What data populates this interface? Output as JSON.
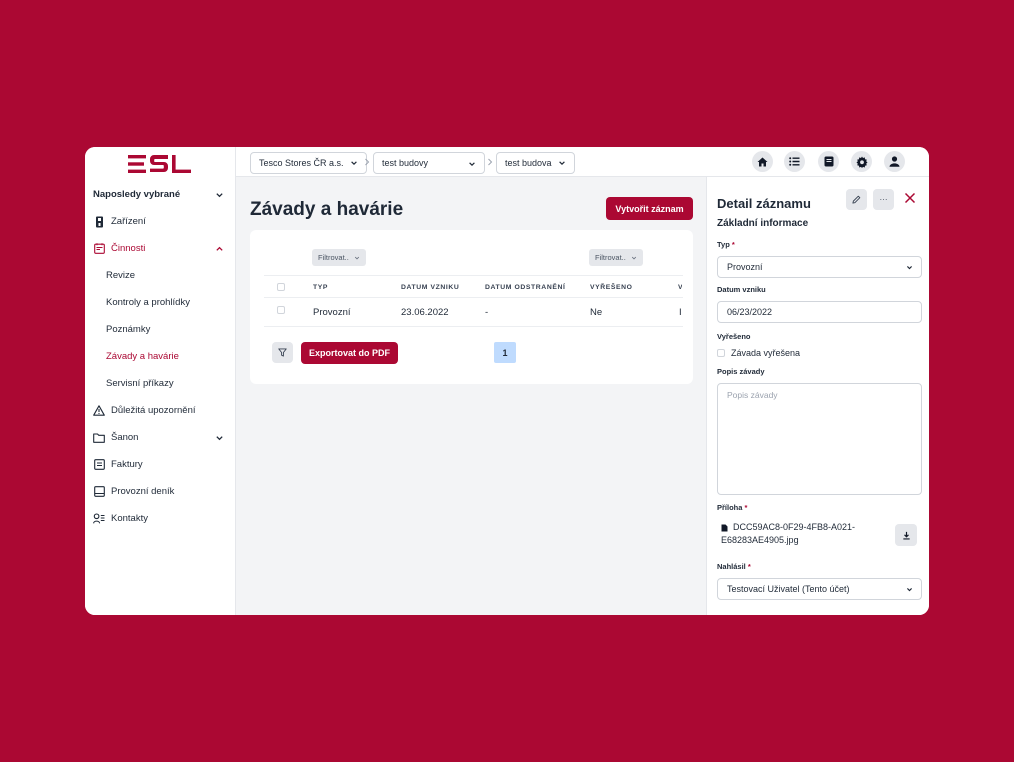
{
  "app": {
    "logo": "ESL",
    "accent": "#ab0833"
  },
  "breadcrumbs": [
    {
      "label": "Tesco Stores ČR a.s."
    },
    {
      "label": "test budovy"
    },
    {
      "label": "test budova"
    }
  ],
  "topbar_icons": [
    "home-icon",
    "list-icon",
    "book-icon",
    "gear-icon",
    "user-icon"
  ],
  "sidebar": {
    "items": [
      {
        "label": "Naposledy vybrané",
        "type": "section"
      },
      {
        "label": "Zařízení",
        "icon": "device-icon"
      },
      {
        "label": "Činnosti",
        "icon": "calendar-icon",
        "state": "expanded"
      },
      {
        "label": "Revize"
      },
      {
        "label": "Kontroly a prohlídky"
      },
      {
        "label": "Poznámky"
      },
      {
        "label": "Závady a havárie",
        "state": "active"
      },
      {
        "label": "Servisní příkazy"
      },
      {
        "label": "Důležitá upozornění",
        "icon": "warning-icon"
      },
      {
        "label": "Šanon",
        "icon": "folder-icon"
      },
      {
        "label": "Faktury",
        "icon": "invoice-icon"
      },
      {
        "label": "Provozní deník",
        "icon": "book-icon"
      },
      {
        "label": "Kontakty",
        "icon": "contacts-icon"
      }
    ]
  },
  "main": {
    "title": "Závady a havárie",
    "create_button": "Vytvořit záznam",
    "filters": [
      "Filtrovat..",
      "Filtrovat.."
    ],
    "columns": [
      "TYP",
      "DATUM VZNIKU",
      "DATUM ODSTRANĚNÍ",
      "VYŘEŠENO"
    ],
    "rows": [
      {
        "typ": "Provozní",
        "datum_vzniku": "23.06.2022",
        "datum_odstraneni": "-",
        "vyreseno": "Ne"
      }
    ],
    "export_button": "Exportovat do PDF",
    "current_page": "1"
  },
  "detail": {
    "title": "Detail záznamu",
    "subtitle": "Základní informace",
    "more_label": "···",
    "typ": {
      "label": "Typ",
      "value": "Provozní"
    },
    "datum_vzniku": {
      "label": "Datum vzniku",
      "value": "06/23/2022"
    },
    "vyreseno": {
      "label": "Vyřešeno",
      "checkbox_label": "Závada vyřešena",
      "checked": false
    },
    "popis": {
      "label": "Popis závady",
      "placeholder": "Popis závady"
    },
    "priloha": {
      "label": "Příloha",
      "file_name": "DCC59AC8-0F29-4FB8-A021-E68283AE4905.jpg"
    },
    "nahlasil": {
      "label": "Nahlásil",
      "value": "Testovací Uživatel (Tento účet)"
    }
  }
}
